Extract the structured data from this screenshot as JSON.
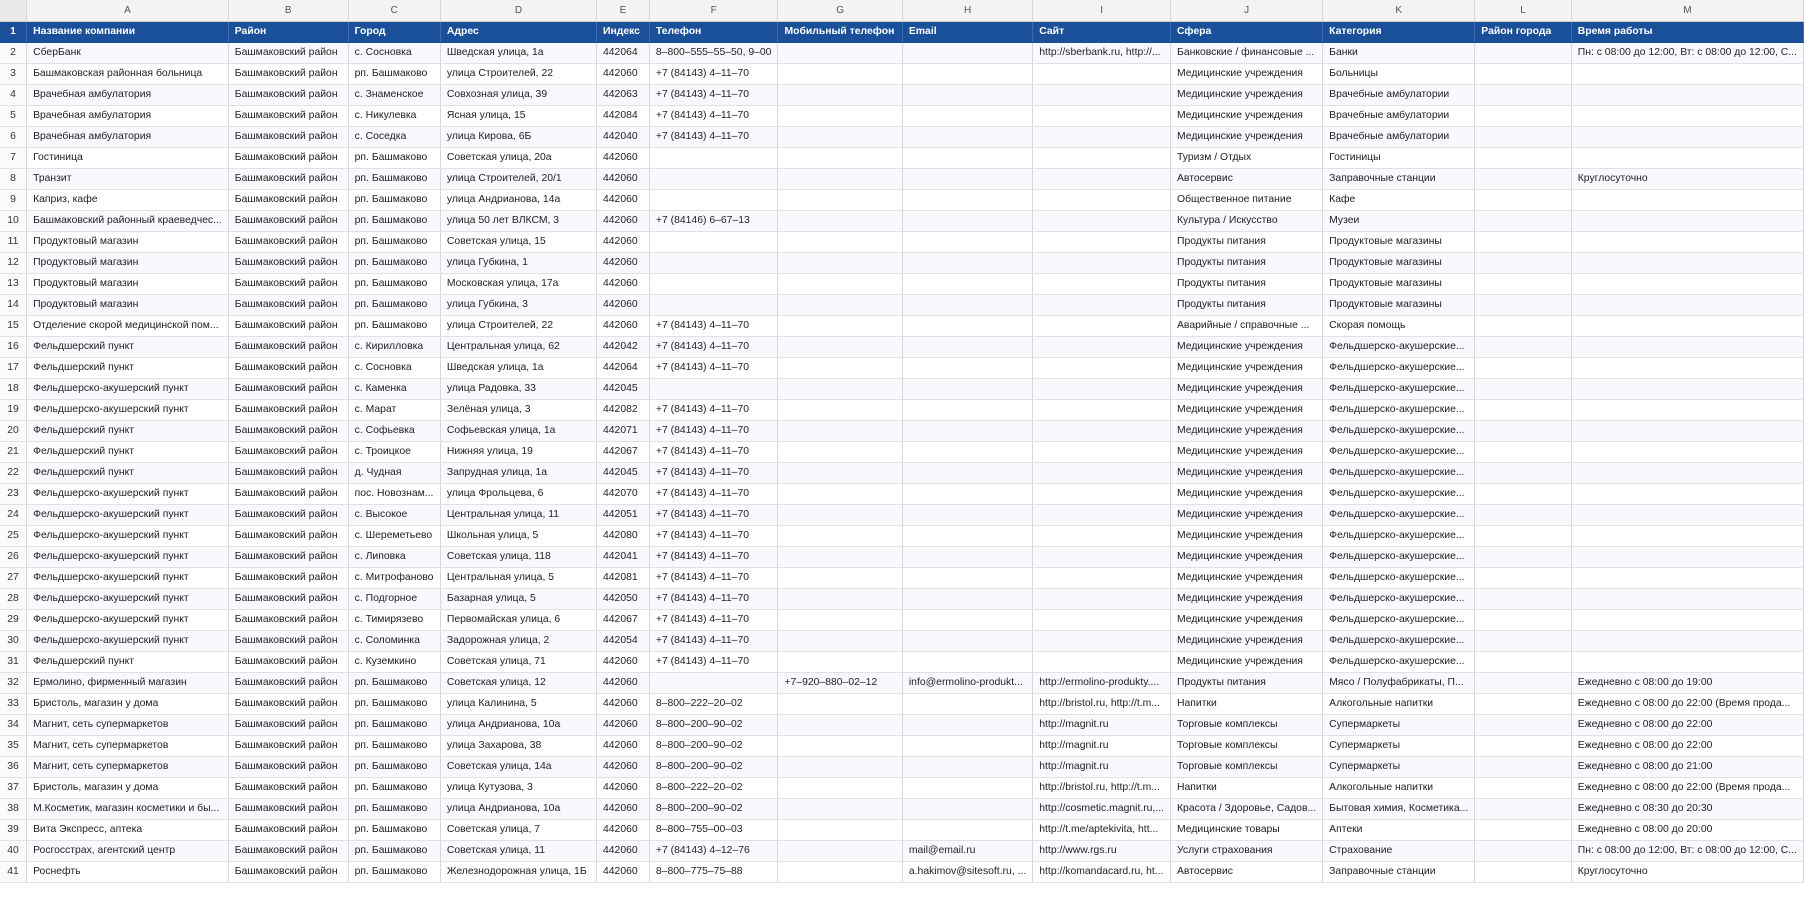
{
  "columns": [
    {
      "letter": "A",
      "header": "Название компании"
    },
    {
      "letter": "B",
      "header": "Район"
    },
    {
      "letter": "C",
      "header": "Город"
    },
    {
      "letter": "D",
      "header": "Адрес"
    },
    {
      "letter": "E",
      "header": "Индекс"
    },
    {
      "letter": "F",
      "header": "Телефон"
    },
    {
      "letter": "G",
      "header": "Мобильный телефон"
    },
    {
      "letter": "H",
      "header": "Email"
    },
    {
      "letter": "I",
      "header": "Сайт"
    },
    {
      "letter": "J",
      "header": "Сфера"
    },
    {
      "letter": "K",
      "header": "Категория"
    },
    {
      "letter": "L",
      "header": "Район города"
    },
    {
      "letter": "M",
      "header": "Время работы"
    }
  ],
  "header_row_number": "1",
  "rows": [
    {
      "n": "2",
      "cells": [
        "СберБанк",
        "Башмаковский район",
        "с. Сосновка",
        "Шведская улица, 1а",
        "442064",
        "8–800–555–55–50, 9–00",
        "",
        "",
        "http://sberbank.ru, http://...",
        "Банковские / финансовые ...",
        "Банки",
        "",
        "Пн: с 08:00 до 12:00, Вт: с 08:00 до 12:00, С..."
      ]
    },
    {
      "n": "3",
      "cells": [
        "Башмаковская районная больница",
        "Башмаковский район",
        "рп. Башмаково",
        "улица Строителей, 22",
        "442060",
        "+7 (84143) 4–11–70",
        "",
        "",
        "",
        "Медицинские учреждения",
        "Больницы",
        "",
        ""
      ]
    },
    {
      "n": "4",
      "cells": [
        "Врачебная амбулатория",
        "Башмаковский район",
        "с. Знаменское",
        "Совхозная улица, 39",
        "442063",
        "+7 (84143) 4–11–70",
        "",
        "",
        "",
        "Медицинские учреждения",
        "Врачебные амбулатории",
        "",
        ""
      ]
    },
    {
      "n": "5",
      "cells": [
        "Врачебная амбулатория",
        "Башмаковский район",
        "с. Никулевка",
        "Ясная улица, 15",
        "442084",
        "+7 (84143) 4–11–70",
        "",
        "",
        "",
        "Медицинские учреждения",
        "Врачебные амбулатории",
        "",
        ""
      ]
    },
    {
      "n": "6",
      "cells": [
        "Врачебная амбулатория",
        "Башмаковский район",
        "с. Соседка",
        "улица Кирова, 6Б",
        "442040",
        "+7 (84143) 4–11–70",
        "",
        "",
        "",
        "Медицинские учреждения",
        "Врачебные амбулатории",
        "",
        ""
      ]
    },
    {
      "n": "7",
      "cells": [
        "Гостиница",
        "Башмаковский район",
        "рп. Башмаково",
        "Советская улица, 20а",
        "442060",
        "",
        "",
        "",
        "",
        "Туризм / Отдых",
        "Гостиницы",
        "",
        ""
      ]
    },
    {
      "n": "8",
      "cells": [
        "Транзит",
        "Башмаковский район",
        "рп. Башмаково",
        "улица Строителей, 20/1",
        "442060",
        "",
        "",
        "",
        "",
        "Автосервис",
        "Заправочные станции",
        "",
        "Круглосуточно"
      ]
    },
    {
      "n": "9",
      "cells": [
        "Каприз, кафе",
        "Башмаковский район",
        "рп. Башмаково",
        "улица Андрианова, 14а",
        "442060",
        "",
        "",
        "",
        "",
        "Общественное питание",
        "Кафе",
        "",
        ""
      ]
    },
    {
      "n": "10",
      "cells": [
        "Башмаковский районный краеведчес...",
        "Башмаковский район",
        "рп. Башмаково",
        "улица 50 лет ВЛКСМ, 3",
        "442060",
        "+7 (84146) 6–67–13",
        "",
        "",
        "",
        "Культура / Искусство",
        "Музеи",
        "",
        ""
      ]
    },
    {
      "n": "11",
      "cells": [
        "Продуктовый магазин",
        "Башмаковский район",
        "рп. Башмаково",
        "Советская улица, 15",
        "442060",
        "",
        "",
        "",
        "",
        "Продукты питания",
        "Продуктовые магазины",
        "",
        ""
      ]
    },
    {
      "n": "12",
      "cells": [
        "Продуктовый магазин",
        "Башмаковский район",
        "рп. Башмаково",
        "улица Губкина, 1",
        "442060",
        "",
        "",
        "",
        "",
        "Продукты питания",
        "Продуктовые магазины",
        "",
        ""
      ]
    },
    {
      "n": "13",
      "cells": [
        "Продуктовый магазин",
        "Башмаковский район",
        "рп. Башмаково",
        "Московская улица, 17а",
        "442060",
        "",
        "",
        "",
        "",
        "Продукты питания",
        "Продуктовые магазины",
        "",
        ""
      ]
    },
    {
      "n": "14",
      "cells": [
        "Продуктовый магазин",
        "Башмаковский район",
        "рп. Башмаково",
        "улица Губкина, 3",
        "442060",
        "",
        "",
        "",
        "",
        "Продукты питания",
        "Продуктовые магазины",
        "",
        ""
      ]
    },
    {
      "n": "15",
      "cells": [
        "Отделение скорой медицинской пом...",
        "Башмаковский район",
        "рп. Башмаково",
        "улица Строителей, 22",
        "442060",
        "+7 (84143) 4–11–70",
        "",
        "",
        "",
        "Аварийные / справочные ...",
        "Скорая помощь",
        "",
        ""
      ]
    },
    {
      "n": "16",
      "cells": [
        "Фельдшерский пункт",
        "Башмаковский район",
        "с. Кирилловка",
        "Центральная улица, 62",
        "442042",
        "+7 (84143) 4–11–70",
        "",
        "",
        "",
        "Медицинские учреждения",
        "Фельдшерско-акушерские...",
        "",
        ""
      ]
    },
    {
      "n": "17",
      "cells": [
        "Фельдшерский пункт",
        "Башмаковский район",
        "с. Сосновка",
        "Шведская улица, 1а",
        "442064",
        "+7 (84143) 4–11–70",
        "",
        "",
        "",
        "Медицинские учреждения",
        "Фельдшерско-акушерские...",
        "",
        ""
      ]
    },
    {
      "n": "18",
      "cells": [
        "Фельдшерско-акушерский пункт",
        "Башмаковский район",
        "с. Каменка",
        "улица Радовка, 33",
        "442045",
        "",
        "",
        "",
        "",
        "Медицинские учреждения",
        "Фельдшерско-акушерские...",
        "",
        ""
      ]
    },
    {
      "n": "19",
      "cells": [
        "Фельдшерско-акушерский пункт",
        "Башмаковский район",
        "с. Марат",
        "Зелёная улица, 3",
        "442082",
        "+7 (84143) 4–11–70",
        "",
        "",
        "",
        "Медицинские учреждения",
        "Фельдшерско-акушерские...",
        "",
        ""
      ]
    },
    {
      "n": "20",
      "cells": [
        "Фельдшерский пункт",
        "Башмаковский район",
        "с. Софьевка",
        "Софьевская улица, 1а",
        "442071",
        "+7 (84143) 4–11–70",
        "",
        "",
        "",
        "Медицинские учреждения",
        "Фельдшерско-акушерские...",
        "",
        ""
      ]
    },
    {
      "n": "21",
      "cells": [
        "Фельдшерский пункт",
        "Башмаковский район",
        "с. Троицкое",
        "Нижняя улица, 19",
        "442067",
        "+7 (84143) 4–11–70",
        "",
        "",
        "",
        "Медицинские учреждения",
        "Фельдшерско-акушерские...",
        "",
        ""
      ]
    },
    {
      "n": "22",
      "cells": [
        "Фельдшерский пункт",
        "Башмаковский район",
        "д. Чудная",
        "Запрудная улица, 1а",
        "442045",
        "+7 (84143) 4–11–70",
        "",
        "",
        "",
        "Медицинские учреждения",
        "Фельдшерско-акушерские...",
        "",
        ""
      ]
    },
    {
      "n": "23",
      "cells": [
        "Фельдшерско-акушерский пункт",
        "Башмаковский район",
        "пос. Новознам...",
        "улица Фрольцева, 6",
        "442070",
        "+7 (84143) 4–11–70",
        "",
        "",
        "",
        "Медицинские учреждения",
        "Фельдшерско-акушерские...",
        "",
        ""
      ]
    },
    {
      "n": "24",
      "cells": [
        "Фельдшерско-акушерский пункт",
        "Башмаковский район",
        "с. Высокое",
        "Центральная улица, 11",
        "442051",
        "+7 (84143) 4–11–70",
        "",
        "",
        "",
        "Медицинские учреждения",
        "Фельдшерско-акушерские...",
        "",
        ""
      ]
    },
    {
      "n": "25",
      "cells": [
        "Фельдшерско-акушерский пункт",
        "Башмаковский район",
        "с. Шереметьево",
        "Школьная улица, 5",
        "442080",
        "+7 (84143) 4–11–70",
        "",
        "",
        "",
        "Медицинские учреждения",
        "Фельдшерско-акушерские...",
        "",
        ""
      ]
    },
    {
      "n": "26",
      "cells": [
        "Фельдшерско-акушерский пункт",
        "Башмаковский район",
        "с. Липовка",
        "Советская улица, 118",
        "442041",
        "+7 (84143) 4–11–70",
        "",
        "",
        "",
        "Медицинские учреждения",
        "Фельдшерско-акушерские...",
        "",
        ""
      ]
    },
    {
      "n": "27",
      "cells": [
        "Фельдшерско-акушерский пункт",
        "Башмаковский район",
        "с. Митрофаново",
        "Центральная улица, 5",
        "442081",
        "+7 (84143) 4–11–70",
        "",
        "",
        "",
        "Медицинские учреждения",
        "Фельдшерско-акушерские...",
        "",
        ""
      ]
    },
    {
      "n": "28",
      "cells": [
        "Фельдшерско-акушерский пункт",
        "Башмаковский район",
        "с. Подгорное",
        "Базарная улица, 5",
        "442050",
        "+7 (84143) 4–11–70",
        "",
        "",
        "",
        "Медицинские учреждения",
        "Фельдшерско-акушерские...",
        "",
        ""
      ]
    },
    {
      "n": "29",
      "cells": [
        "Фельдшерско-акушерский пункт",
        "Башмаковский район",
        "с. Тимирязево",
        "Первомайская улица, 6",
        "442067",
        "+7 (84143) 4–11–70",
        "",
        "",
        "",
        "Медицинские учреждения",
        "Фельдшерско-акушерские...",
        "",
        ""
      ]
    },
    {
      "n": "30",
      "cells": [
        "Фельдшерско-акушерский пункт",
        "Башмаковский район",
        "с. Соломинка",
        "Задорожная улица, 2",
        "442054",
        "+7 (84143) 4–11–70",
        "",
        "",
        "",
        "Медицинские учреждения",
        "Фельдшерско-акушерские...",
        "",
        ""
      ]
    },
    {
      "n": "31",
      "cells": [
        "Фельдшерский пункт",
        "Башмаковский район",
        "с. Куземкино",
        "Советская улица, 71",
        "442060",
        "+7 (84143) 4–11–70",
        "",
        "",
        "",
        "Медицинские учреждения",
        "Фельдшерско-акушерские...",
        "",
        ""
      ]
    },
    {
      "n": "32",
      "cells": [
        "Ермолино, фирменный магазин",
        "Башмаковский район",
        "рп. Башмаково",
        "Советская улица, 12",
        "442060",
        "",
        "+7–920–880–02–12",
        "info@ermolino-produkt...",
        "http://ermolino-produkty....",
        "Продукты питания",
        "Мясо / Полуфабрикаты, П...",
        "",
        "Ежедневно с 08:00 до 19:00"
      ]
    },
    {
      "n": "33",
      "cells": [
        "Бристоль, магазин у дома",
        "Башмаковский район",
        "рп. Башмаково",
        "улица Калинина, 5",
        "442060",
        "8–800–222–20–02",
        "",
        "",
        "http://bristol.ru, http://t.m...",
        "Напитки",
        "Алкогольные напитки",
        "",
        "Ежедневно с 08:00 до 22:00 (Время прода..."
      ]
    },
    {
      "n": "34",
      "cells": [
        "Магнит, сеть супермаркетов",
        "Башмаковский район",
        "рп. Башмаково",
        "улица Андрианова, 10а",
        "442060",
        "8–800–200–90–02",
        "",
        "",
        "http://magnit.ru",
        "Торговые комплексы",
        "Супермаркеты",
        "",
        "Ежедневно с 08:00 до 22:00"
      ]
    },
    {
      "n": "35",
      "cells": [
        "Магнит, сеть супермаркетов",
        "Башмаковский район",
        "рп. Башмаково",
        "улица Захарова, 38",
        "442060",
        "8–800–200–90–02",
        "",
        "",
        "http://magnit.ru",
        "Торговые комплексы",
        "Супермаркеты",
        "",
        "Ежедневно с 08:00 до 22:00"
      ]
    },
    {
      "n": "36",
      "cells": [
        "Магнит, сеть супермаркетов",
        "Башмаковский район",
        "рп. Башмаково",
        "Советская улица, 14а",
        "442060",
        "8–800–200–90–02",
        "",
        "",
        "http://magnit.ru",
        "Торговые комплексы",
        "Супермаркеты",
        "",
        "Ежедневно с 08:00 до 21:00"
      ]
    },
    {
      "n": "37",
      "cells": [
        "Бристоль, магазин у дома",
        "Башмаковский район",
        "рп. Башмаково",
        "улица Кутузова, 3",
        "442060",
        "8–800–222–20–02",
        "",
        "",
        "http://bristol.ru, http://t.m...",
        "Напитки",
        "Алкогольные напитки",
        "",
        "Ежедневно с 08:00 до 22:00 (Время прода..."
      ]
    },
    {
      "n": "38",
      "cells": [
        "М.Косметик, магазин косметики и бы...",
        "Башмаковский район",
        "рп. Башмаково",
        "улица Андрианова, 10а",
        "442060",
        "8–800–200–90–02",
        "",
        "",
        "http://cosmetic.magnit.ru,...",
        "Красота / Здоровье, Садов...",
        "Бытовая химия, Косметика...",
        "",
        "Ежедневно с 08:30 до 20:30"
      ]
    },
    {
      "n": "39",
      "cells": [
        "Вита Экспресс, аптека",
        "Башмаковский район",
        "рп. Башмаково",
        "Советская улица, 7",
        "442060",
        "8–800–755–00–03",
        "",
        "",
        "http://t.me/aptekivita, htt...",
        "Медицинские товары",
        "Аптеки",
        "",
        "Ежедневно с 08:00 до 20:00"
      ]
    },
    {
      "n": "40",
      "cells": [
        "Росгосстрах, агентский центр",
        "Башмаковский район",
        "рп. Башмаково",
        "Советская улица, 11",
        "442060",
        "+7 (84143) 4–12–76",
        "",
        "mail@email.ru",
        "http://www.rgs.ru",
        "Услуги страхования",
        "Страхование",
        "",
        "Пн: с 08:00 до 12:00, Вт: с 08:00 до 12:00, С..."
      ]
    },
    {
      "n": "41",
      "cells": [
        "Роснефть",
        "Башмаковский район",
        "рп. Башмаково",
        "Железнодорожная улица, 1Б",
        "442060",
        "8–800–775–75–88",
        "",
        "a.hakimov@sitesoft.ru, ...",
        "http://komandacard.ru, ht...",
        "Автосервис",
        "Заправочные станции",
        "",
        "Круглосуточно"
      ]
    }
  ]
}
